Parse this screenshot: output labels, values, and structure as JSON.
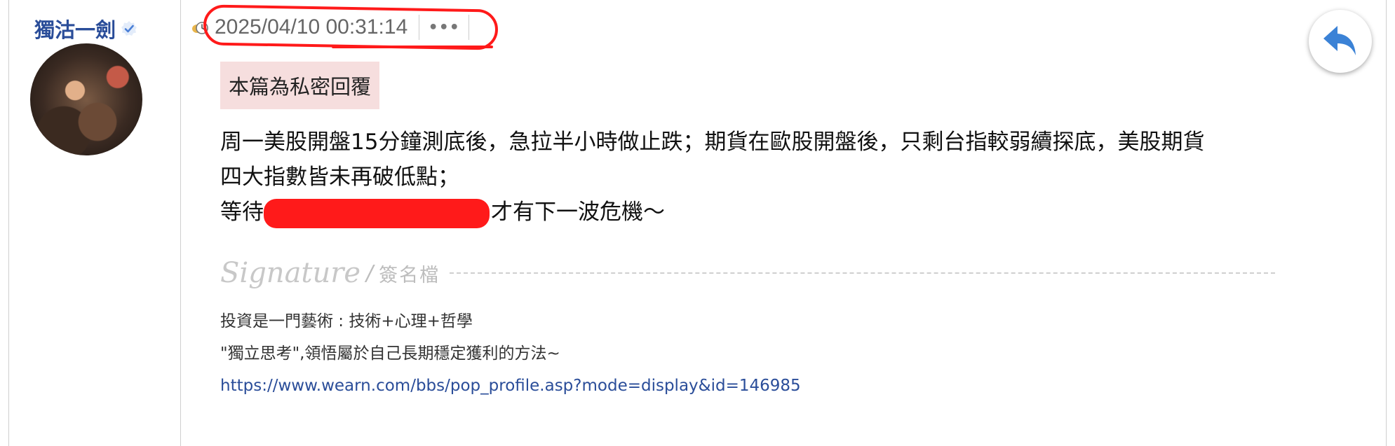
{
  "user": {
    "name": "獨沽一劍",
    "verified_icon": "verified-check-icon",
    "accent_color": "#2a4d99"
  },
  "post": {
    "timestamp": "2025/04/10 00:31:14",
    "more_label": "•••",
    "private_notice": "本篇為私密回覆",
    "content": {
      "line1": "周一美股開盤15分鐘測底後，急拉半小時做止跌；期貨在歐股開盤後，只剩台指較弱續探底，美股期貨",
      "line2": "四大指數皆未再破低點；",
      "line3_prefix": "等待",
      "line3_suffix": "才有下一波危機～"
    }
  },
  "signature": {
    "script_label": "Signature",
    "slash": "/",
    "cn_label": "簽名檔",
    "line1": "投資是一門藝術 : 技術+心理+哲學",
    "line2": "\"獨立思考\",領悟屬於自己長期穩定獲利的方法~",
    "link": "https://www.wearn.com/bbs/pop_profile.asp?mode=display&id=146985"
  },
  "colors": {
    "annotation_red": "#ff1a1a",
    "private_bg": "#f6dede",
    "link": "#2a4d99"
  }
}
